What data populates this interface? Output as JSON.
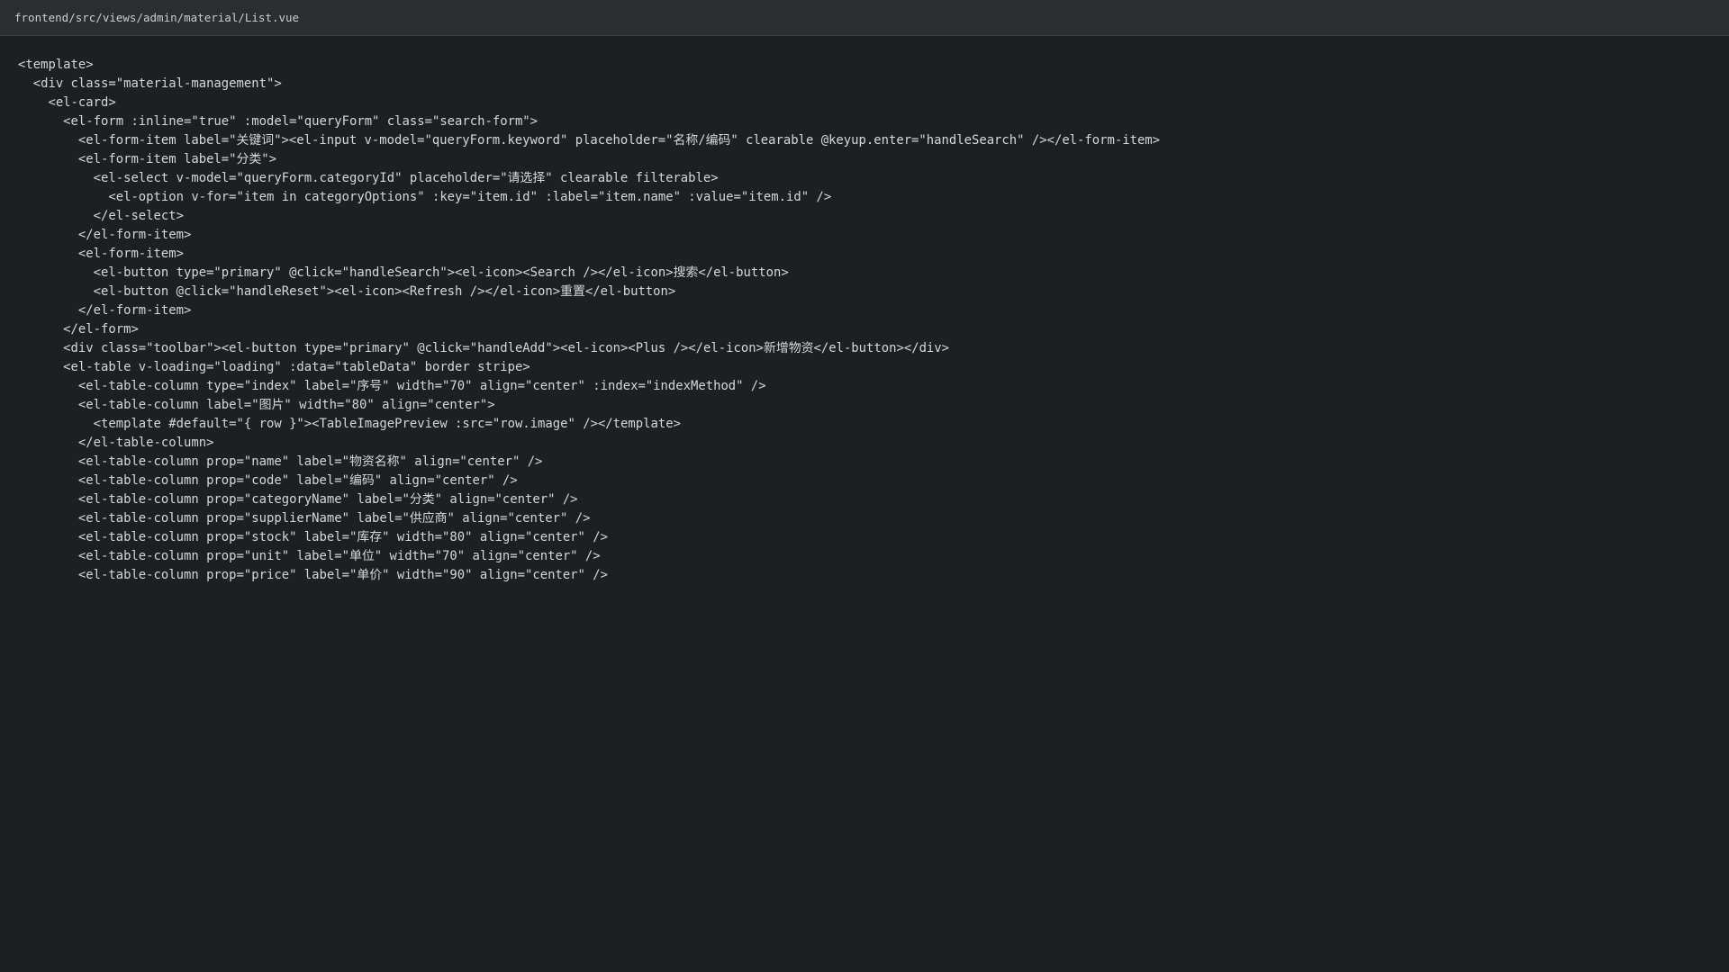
{
  "window": {
    "file_path": "frontend/src/views/admin/material/List.vue"
  },
  "code": {
    "lines": [
      "<template>",
      "  <div class=\"material-management\">",
      "    <el-card>",
      "      <el-form :inline=\"true\" :model=\"queryForm\" class=\"search-form\">",
      "        <el-form-item label=\"关键词\"><el-input v-model=\"queryForm.keyword\" placeholder=\"名称/编码\" clearable @keyup.enter=\"handleSearch\" /></el-form-item>",
      "        <el-form-item label=\"分类\">",
      "          <el-select v-model=\"queryForm.categoryId\" placeholder=\"请选择\" clearable filterable>",
      "            <el-option v-for=\"item in categoryOptions\" :key=\"item.id\" :label=\"item.name\" :value=\"item.id\" />",
      "          </el-select>",
      "        </el-form-item>",
      "        <el-form-item>",
      "          <el-button type=\"primary\" @click=\"handleSearch\"><el-icon><Search /></el-icon>搜索</el-button>",
      "          <el-button @click=\"handleReset\"><el-icon><Refresh /></el-icon>重置</el-button>",
      "        </el-form-item>",
      "      </el-form>",
      "      <div class=\"toolbar\"><el-button type=\"primary\" @click=\"handleAdd\"><el-icon><Plus /></el-icon>新增物资</el-button></div>",
      "      <el-table v-loading=\"loading\" :data=\"tableData\" border stripe>",
      "        <el-table-column type=\"index\" label=\"序号\" width=\"70\" align=\"center\" :index=\"indexMethod\" />",
      "        <el-table-column label=\"图片\" width=\"80\" align=\"center\">",
      "          <template #default=\"{ row }\"><TableImagePreview :src=\"row.image\" /></template>",
      "        </el-table-column>",
      "        <el-table-column prop=\"name\" label=\"物资名称\" align=\"center\" />",
      "        <el-table-column prop=\"code\" label=\"编码\" align=\"center\" />",
      "        <el-table-column prop=\"categoryName\" label=\"分类\" align=\"center\" />",
      "        <el-table-column prop=\"supplierName\" label=\"供应商\" align=\"center\" />",
      "        <el-table-column prop=\"stock\" label=\"库存\" width=\"80\" align=\"center\" />",
      "        <el-table-column prop=\"unit\" label=\"单位\" width=\"70\" align=\"center\" />",
      "        <el-table-column prop=\"price\" label=\"单价\" width=\"90\" align=\"center\" />"
    ]
  }
}
